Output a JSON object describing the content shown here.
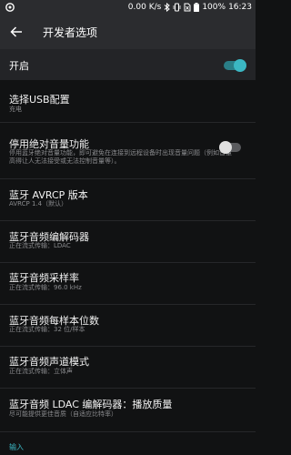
{
  "status_bar": {
    "speed": "0.00 K/s",
    "battery": "100%",
    "time": "16:23"
  },
  "app_bar": {
    "title": "开发者选项"
  },
  "master": {
    "label": "开启",
    "enabled": true
  },
  "items": [
    {
      "title": "选择USB配置",
      "subtitle": "充电"
    },
    {
      "title": "停用绝对音量功能",
      "subtitle": "停用蓝牙绝对音量功能，即可避免在连接到远程设备时出现音量问题（例如音量高得让人无法接受或无法控制音量等）。",
      "toggle": false
    },
    {
      "title": "蓝牙 AVRCP 版本",
      "subtitle": "AVRCP 1.4（默认）"
    },
    {
      "title": "蓝牙音频编解码器",
      "subtitle": "正在流式传输：LDAC"
    },
    {
      "title": "蓝牙音频采样率",
      "subtitle": "正在流式传输：96.0 kHz"
    },
    {
      "title": "蓝牙音频每样本位数",
      "subtitle": "正在流式传输：32 位/样本"
    },
    {
      "title": "蓝牙音频声道模式",
      "subtitle": "正在流式传输：立体声"
    },
    {
      "title": "蓝牙音频 LDAC 编解码器：播放质量",
      "subtitle": "尽可能提供更佳音质（自适应比特率）"
    }
  ],
  "footer": {
    "label": "输入"
  },
  "colors": {
    "accent": "#3bb7c3",
    "background": "#111213",
    "appbar": "#2b2c2f"
  }
}
